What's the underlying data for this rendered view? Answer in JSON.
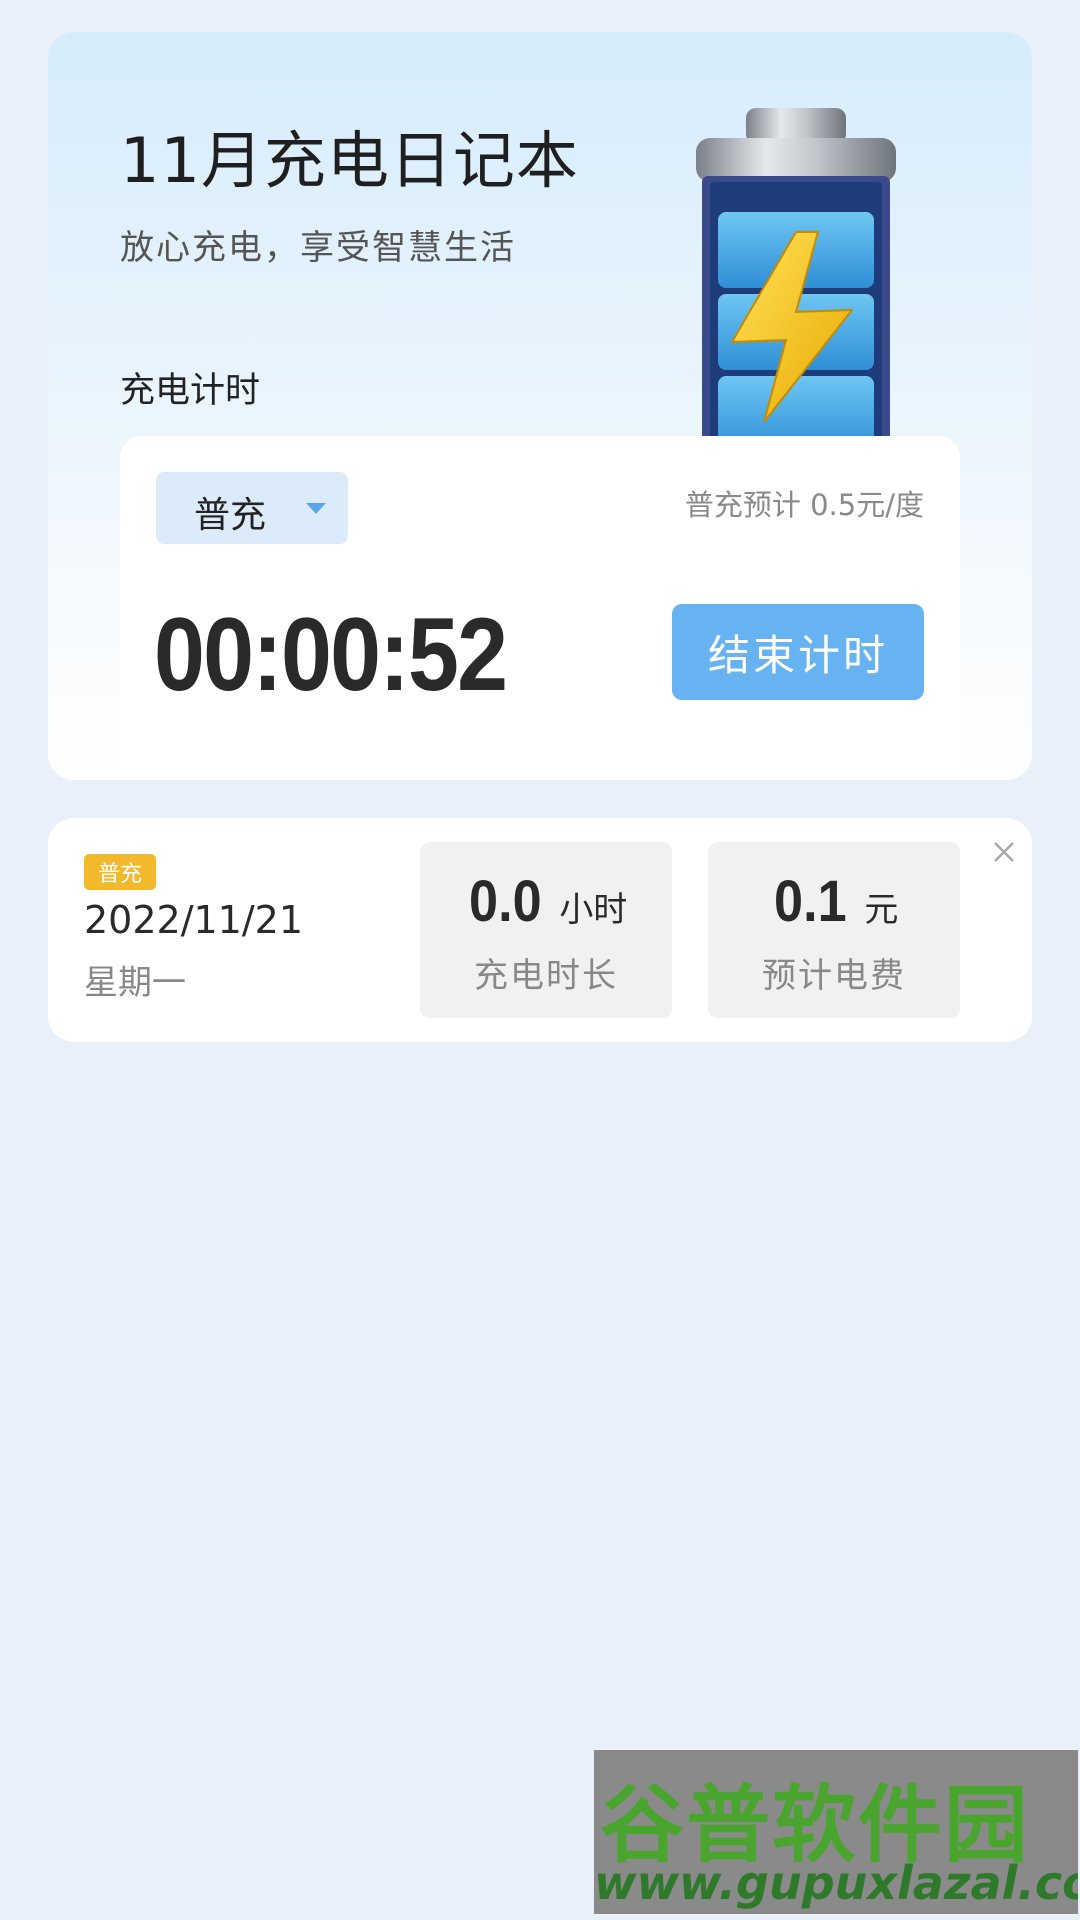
{
  "header": {
    "title": "11月充电日记本",
    "subtitle": "放心充电，享受智慧生活",
    "section_label": "充电计时"
  },
  "timer": {
    "mode": "普充",
    "price_note": "普充预计 0.5元/度",
    "elapsed": "00:00:52",
    "end_button": "结束计时"
  },
  "record": {
    "badge": "普充",
    "date": "2022/11/21",
    "weekday": "星期一",
    "duration": {
      "value": "0.0",
      "unit": "小时",
      "caption": "充电时长"
    },
    "cost": {
      "value": "0.1",
      "unit": "元",
      "caption": "预计电费"
    }
  },
  "watermark": {
    "logo_text": "谷普软件园",
    "url": "www.gupuxlazal.com"
  },
  "colors": {
    "accent": "#67b3f1",
    "badge": "#f2b92c",
    "background": "#eaf0fa"
  },
  "icons": [
    "battery-icon",
    "chevron-down-icon",
    "close-icon"
  ]
}
